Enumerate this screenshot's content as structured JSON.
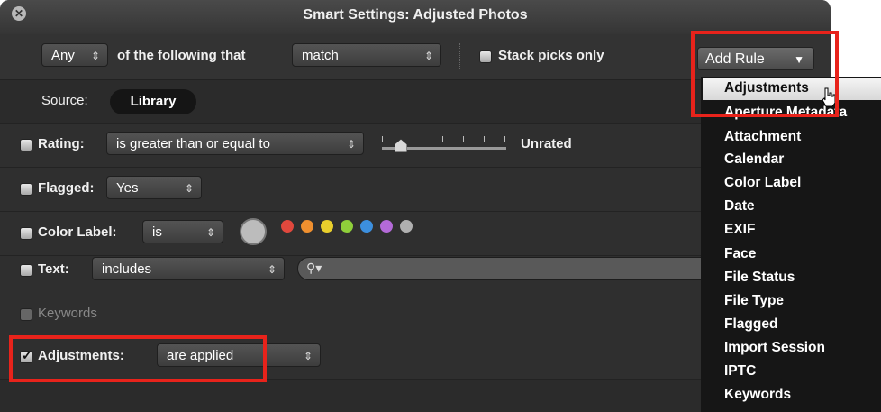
{
  "window": {
    "title": "Smart Settings: Adjusted Photos"
  },
  "toolbar": {
    "any_value": "Any",
    "following_text": "of the following that",
    "match_value": "match",
    "stack_label": "Stack picks only",
    "add_rule_label": "Add Rule"
  },
  "source": {
    "label": "Source:",
    "value": "Library"
  },
  "rules": {
    "rating": {
      "label": "Rating:",
      "op": "is greater than or equal to",
      "value": "Unrated"
    },
    "flagged": {
      "label": "Flagged:",
      "value": "Yes"
    },
    "color_label": {
      "label": "Color Label:",
      "op": "is"
    },
    "text": {
      "label": "Text:",
      "op": "includes"
    },
    "keywords": {
      "label": "Keywords"
    },
    "adjustments": {
      "label": "Adjustments:",
      "value": "are applied",
      "checked": true
    }
  },
  "menu": {
    "items": [
      "Adjustments",
      "Aperture Metadata",
      "Attachment",
      "Calendar",
      "Color Label",
      "Date",
      "EXIF",
      "Face",
      "File Status",
      "File Type",
      "Flagged",
      "Import Session",
      "IPTC",
      "Keywords"
    ],
    "highlighted": "Adjustments"
  },
  "colors": {
    "accent_red": "#e8231b",
    "label_dots": [
      "#e0483d",
      "#f0902f",
      "#e9cf2c",
      "#8fcf3a",
      "#3c8fde",
      "#b46ad8",
      "#b0b0b0"
    ]
  }
}
